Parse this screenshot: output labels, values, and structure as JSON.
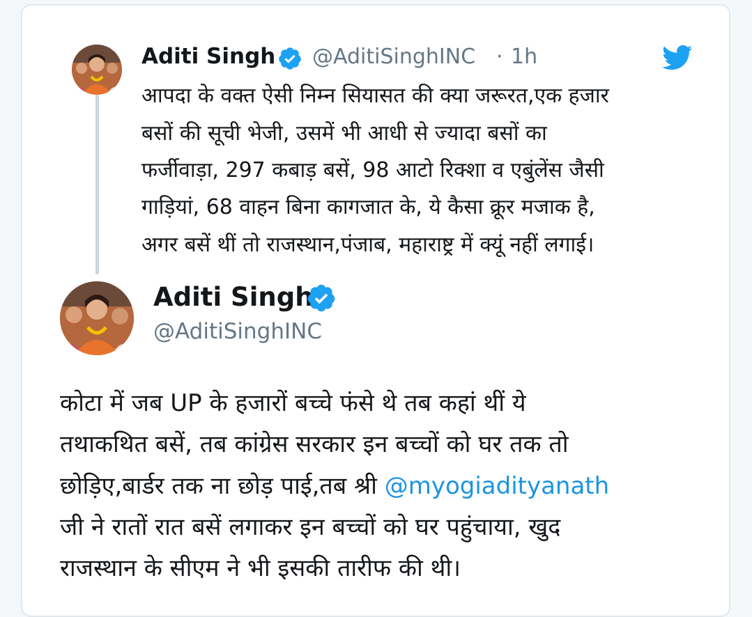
{
  "quoted_tweet": {
    "author_name": "Aditi Singh",
    "author_handle": "@AditiSinghINC",
    "separator": "·",
    "time": "1h",
    "lines": [
      "आपदा के वक्त ऐसी निम्न सियासत की क्या जरूरत,एक हजार",
      "बसों की सूची भेजी, उसमें भी आधी से ज्यादा बसों का",
      "फर्जीवाड़ा, 297 कबाड़ बसें, 98 आटो रिक्शा व एबुंलेंस जैसी",
      "गाड़ियां, 68 वाहन बिना कागजात के, ये कैसा क्रूर मजाक है,",
      "अगर बसें थीं तो राजस्थान,पंजाब, महाराष्ट्र में क्यूं नहीं लगाई।"
    ]
  },
  "reply_tweet": {
    "author_name": "Aditi Singh",
    "author_handle": "@AditiSinghINC",
    "lines": [
      "कोटा में जब UP के हजारों बच्चे फंसे थे तब कहां थीं ये",
      "तथाकथित बसें, तब कांग्रेस सरकार इन बच्चों को घर तक तो",
      "छोड़िए,बार्डर तक ना छोड़ पाई,तब श्री ",
      " जी ने रातों रात बसें लगाकर इन बच्चों को घर पहुंचाया, खुद",
      "राजस्थान के सीएम ने भी इसकी तारीफ की थी।"
    ],
    "mention": "@myogiadityanath"
  },
  "icons": {
    "verified": "verified-badge-icon",
    "bird": "twitter-bird-icon"
  },
  "colors": {
    "text": "#14171a",
    "secondary": "#657786",
    "accent": "#1da1f2",
    "link": "#1b95e0",
    "thread_line": "#ccd6dd"
  }
}
